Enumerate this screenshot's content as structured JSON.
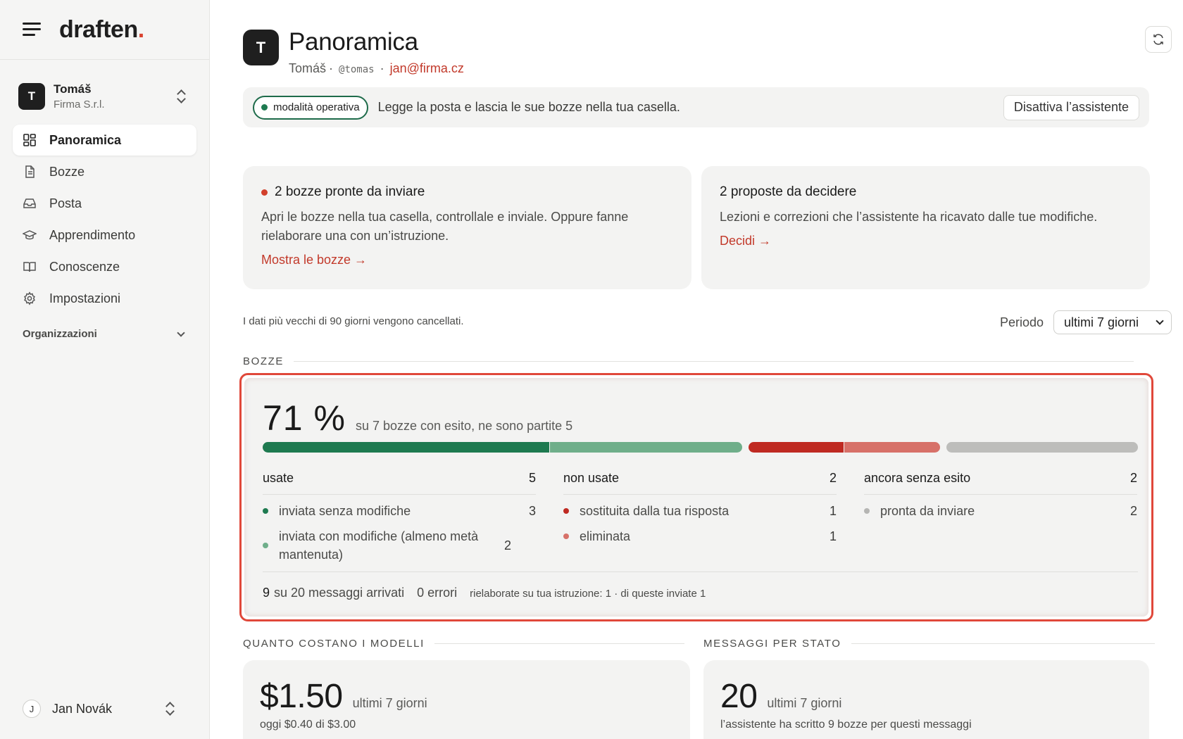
{
  "brand": {
    "name": "draften",
    "dot": "."
  },
  "org": {
    "avatar": "T",
    "name": "Tomáš",
    "company": "Firma S.r.l."
  },
  "nav": [
    {
      "label": "Panoramica",
      "icon": "dashboard-icon",
      "active": true
    },
    {
      "label": "Bozze",
      "icon": "document-icon"
    },
    {
      "label": "Posta",
      "icon": "inbox-icon"
    },
    {
      "label": "Apprendimento",
      "icon": "graduation-cap-icon"
    },
    {
      "label": "Conoscenze",
      "icon": "book-icon"
    },
    {
      "label": "Impostazioni",
      "icon": "gear-icon"
    }
  ],
  "organizations_label": "Organizzazioni",
  "user": {
    "avatar": "J",
    "name": "Jan Novák"
  },
  "header": {
    "avatar": "T",
    "title": "Panoramica",
    "name": "Tomáš",
    "sep1": "·",
    "handle": "@tomas",
    "sep2": "·",
    "email": "jan@firma.cz"
  },
  "mode": {
    "pill": "modalità operativa",
    "description": "Legge la posta e lascia le sue bozze nella tua casella.",
    "button": "Disattiva l’assistente"
  },
  "cards": {
    "drafts_ready": {
      "title": "2 bozze pronte da inviare",
      "body": "Apri le bozze nella tua casella, controllale e inviale. Oppure fanne rielaborare una con un’istruzione.",
      "link": "Mostra le bozze →"
    },
    "proposals": {
      "title": "2 proposte da decidere",
      "body": "Lezioni e correzioni che l’assistente ha ricavato dalle tue modifiche.",
      "link": "Decidi →"
    }
  },
  "retention": "I dati più vecchi di 90 giorni vengono cancellati.",
  "period": {
    "label": "Periodo",
    "selected": "ultimi 7 giorni"
  },
  "sections": {
    "drafts": "BOZZE",
    "costs": "QUANTO COSTANO I MODELLI",
    "messages": "MESSAGGI PER STATO"
  },
  "stats": {
    "rate": "71 %",
    "rate_desc": "su 7 bozze con esito, ne sono partite 5",
    "bar": [
      {
        "name": "inviata senza modifiche",
        "value": 3,
        "color": "#1e7a50"
      },
      {
        "name": "inviata con modifiche",
        "value": 2,
        "color": "#6fae8a"
      },
      {
        "name": "sostituita dalla tua risposta",
        "value": 1,
        "color": "#bf2a22"
      },
      {
        "name": "eliminata",
        "value": 1,
        "color": "#d77169"
      },
      {
        "name": "pronta da inviare",
        "value": 2,
        "color": "#bdbdbb"
      }
    ],
    "columns": [
      {
        "title": "usate",
        "total": "5",
        "rows": [
          {
            "label": "inviata senza modifiche",
            "value": "3",
            "color": "#1e7a50"
          },
          {
            "label": "inviata con modifiche (almeno metà mantenuta)",
            "value": "2",
            "color": "#6fae8a"
          }
        ]
      },
      {
        "title": "non usate",
        "total": "2",
        "rows": [
          {
            "label": "sostituita dalla tua risposta",
            "value": "1",
            "color": "#bf2a22"
          },
          {
            "label": "eliminata",
            "value": "1",
            "color": "#d77169"
          }
        ]
      },
      {
        "title": "ancora senza esito",
        "total": "2",
        "rows": [
          {
            "label": "pronta da inviare",
            "value": "2",
            "color": "#b5b5b3"
          }
        ]
      }
    ],
    "footer": {
      "arrived_count": "9",
      "arrived_text": "su 20 messaggi arrivati",
      "errors": "0 errori",
      "reworked": "rielaborate su tua istruzione: 1 · di queste inviate 1"
    }
  },
  "costs": {
    "amount": "$1.50",
    "period": "ultimi 7 giorni",
    "sub": "oggi $0.40 di $3.00"
  },
  "messages": {
    "count": "20",
    "period": "ultimi 7 giorni",
    "sub": "l’assistente ha scritto 9 bozze per questi messaggi"
  }
}
